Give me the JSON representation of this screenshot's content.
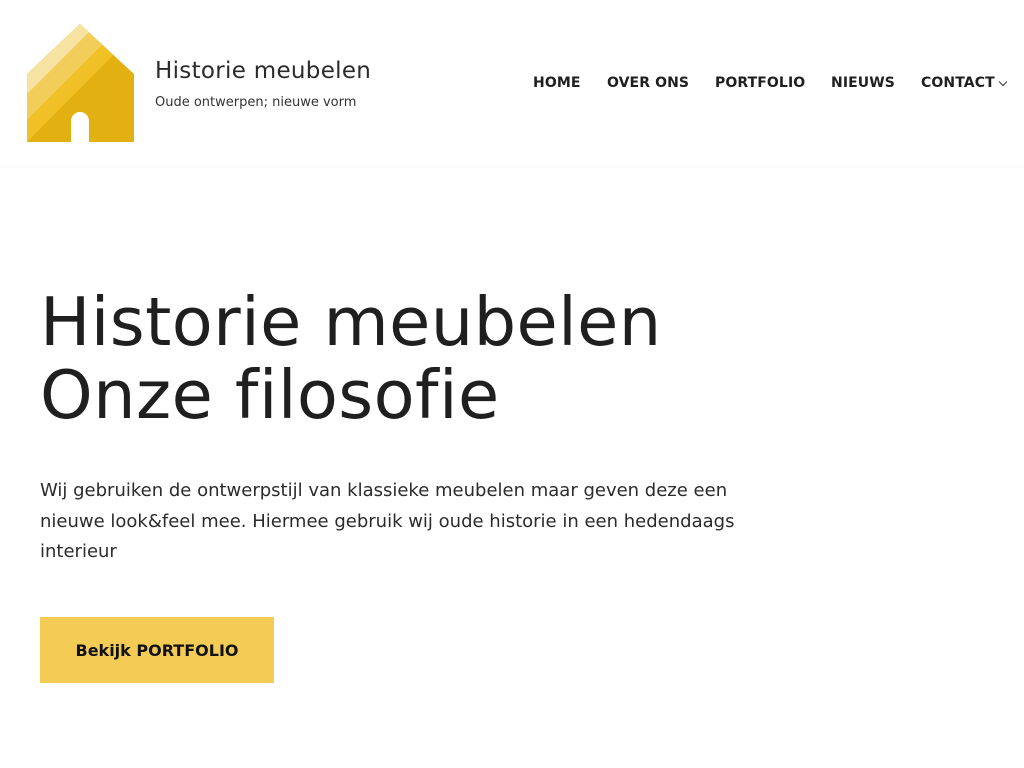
{
  "header": {
    "site_title": "Historie meubelen",
    "tagline": "Oude ontwerpen; nieuwe vorm",
    "logo_icon": "house-logo-icon"
  },
  "nav": {
    "items": [
      {
        "label": "HOME"
      },
      {
        "label": "OVER ONS"
      },
      {
        "label": "PORTFOLIO"
      },
      {
        "label": "NIEUWS"
      },
      {
        "label": "CONTACT",
        "has_dropdown": true
      }
    ],
    "dropdown_icon": "chevron-down-icon"
  },
  "hero": {
    "heading_line1": "Historie meubelen",
    "heading_line2": "Onze filosofie",
    "text": "Wij gebruiken de ontwerpstijl van klassieke meubelen maar geven deze een nieuwe look&feel mee. Hiermee gebruik wij oude historie in een hedendaags interieur",
    "cta_label": "Bekijk PORTFOLIO"
  },
  "colors": {
    "accent": "#f3cb55",
    "logo_light": "#f7e3a1",
    "logo_mid": "#f2cd5a",
    "logo_dark": "#e3b012",
    "text": "#2b2b2b"
  }
}
